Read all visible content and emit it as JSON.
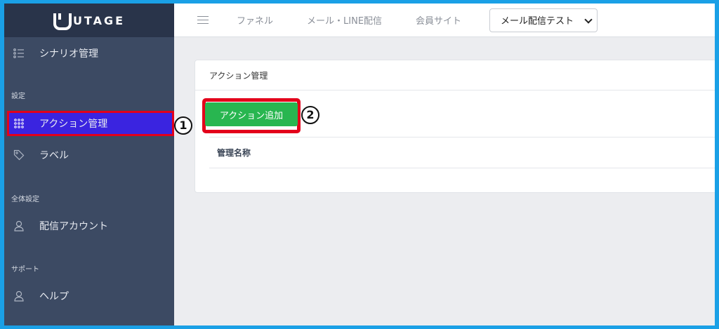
{
  "brand": {
    "name": "UTAGE"
  },
  "sidebar": {
    "items": [
      {
        "label": "シナリオ管理",
        "icon": "list-icon"
      },
      {
        "label": "アクション管理",
        "icon": "grid-dots-icon",
        "active": true
      },
      {
        "label": "ラベル",
        "icon": "tag-icon"
      },
      {
        "label": "配信アカウント",
        "icon": "user-icon"
      },
      {
        "label": "ヘルプ",
        "icon": "user-icon"
      }
    ],
    "sections": [
      "設定",
      "全体設定",
      "サポート"
    ],
    "active_color": "#3a24e0"
  },
  "topnav": {
    "items": [
      "ファネル",
      "メール・LINE配信",
      "会員サイト"
    ],
    "select_value": "メール配信テスト"
  },
  "card": {
    "title": "アクション管理",
    "add_button_label": "アクション追加",
    "table_header": "管理名称"
  },
  "annotations": {
    "step1": "1",
    "step2": "2",
    "highlight_color": "#e3001b"
  },
  "colors": {
    "sidebar_bg": "#3c4a63",
    "logo_bg": "#29344a",
    "button_green": "#28b650"
  }
}
